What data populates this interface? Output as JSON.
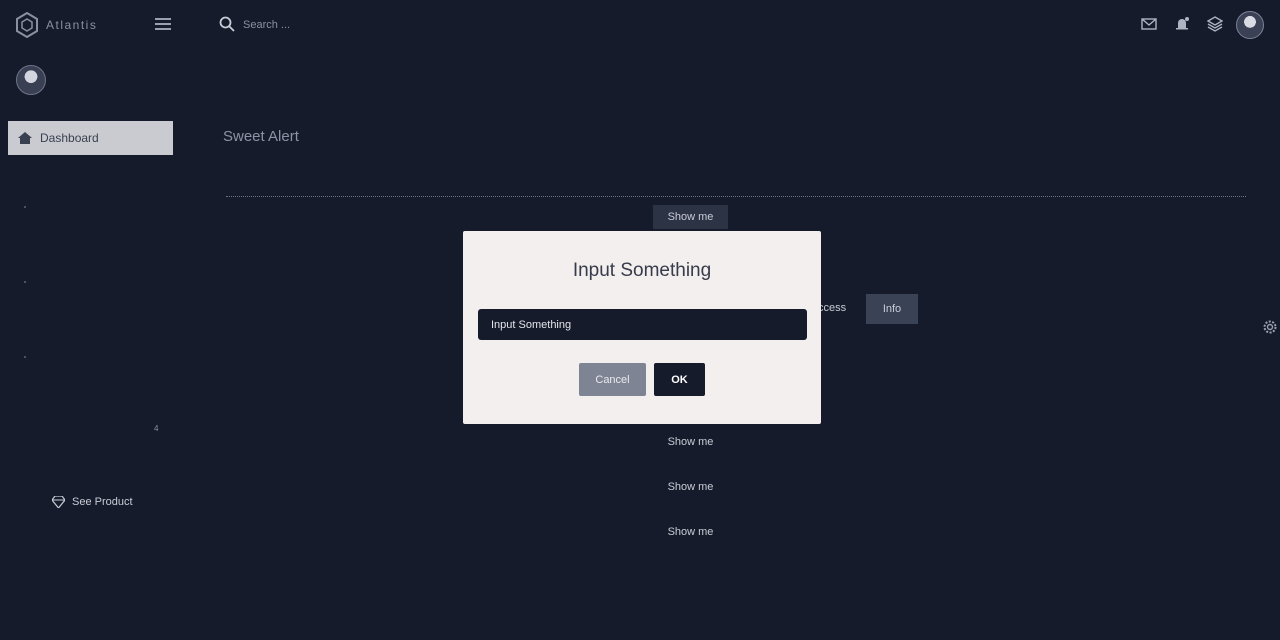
{
  "app": {
    "logo_text": "Atlantis"
  },
  "search": {
    "placeholder": "Search ..."
  },
  "sidebar": {
    "active_item_label": "Dashboard",
    "badge": "4",
    "see_product_label": "See Product"
  },
  "page": {
    "title": "Sweet Alert",
    "buttons": [
      {
        "label": "Show me"
      },
      {
        "label": "Show me"
      },
      {
        "label": "Show me"
      },
      {
        "label": "Show me"
      }
    ],
    "success_fragment": "ccess",
    "info_label": "Info"
  },
  "modal": {
    "title": "Input Something",
    "input_placeholder": "Input Something",
    "cancel_label": "Cancel",
    "ok_label": "OK"
  },
  "colors": {
    "background": "#161b2b",
    "modal_bg": "#f2efee",
    "ok_button": "#161b2b",
    "cancel_button": "#7f8495"
  },
  "icons": {
    "hamburger": "hamburger-icon",
    "search": "search-icon",
    "mail": "mail-icon",
    "notification": "bell-icon",
    "layers": "layers-icon",
    "settings": "gear-icon",
    "home": "home-icon",
    "product": "diamond-icon"
  }
}
